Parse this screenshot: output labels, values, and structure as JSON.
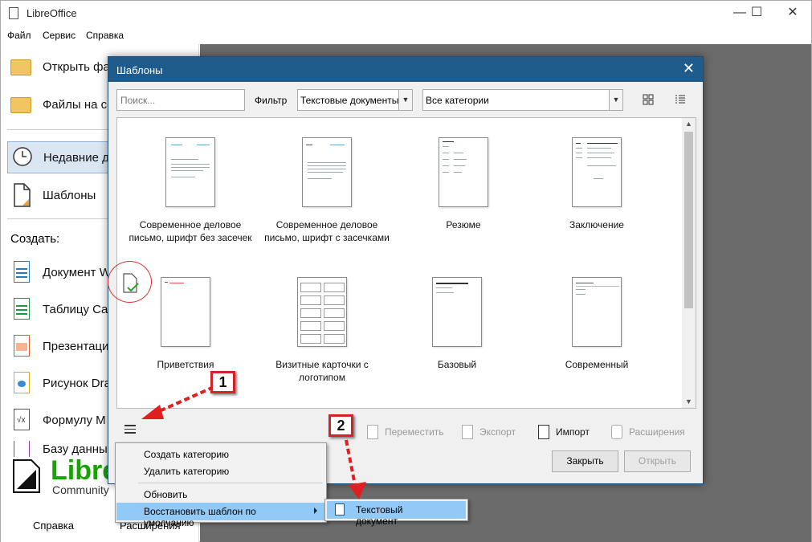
{
  "window": {
    "title": "LibreOffice",
    "controls": {
      "minimize": "—",
      "maximize": "☐",
      "close": "✕"
    }
  },
  "menubar": {
    "items": [
      {
        "label": "Файл"
      },
      {
        "label": "Сервис"
      },
      {
        "label": "Справка"
      }
    ]
  },
  "startcenter": {
    "open_file": "Открыть фа",
    "remote_files": "Файлы на се",
    "recent_docs": "Недавние д",
    "templates": "Шаблоны",
    "create_label": "Создать:",
    "create_items": [
      {
        "label": "Документ W",
        "color": "#2a7ab9"
      },
      {
        "label": "Таблицу Ca",
        "color": "#1e9940"
      },
      {
        "label": "Презентаци",
        "color": "#d95c1f"
      },
      {
        "label": "Рисунок Dra",
        "color": "#e0a81a"
      },
      {
        "label": "Формулу M",
        "color": "#7a7a7a"
      },
      {
        "label": "Базу данны",
        "color": "#8b3aa8"
      }
    ],
    "logo_text": "Libre",
    "logo_sub": "Community",
    "help_link": "Справка",
    "extensions_link": "Расширения"
  },
  "dialog": {
    "title": "Шаблоны",
    "search_placeholder": "Поиск...",
    "filter_label": "Фильтр",
    "filter_value": "Текстовые документы",
    "category_value": "Все категории",
    "templates": [
      {
        "name": "Современное деловое письмо, шрифт без засечек"
      },
      {
        "name": "Современное деловое письмо, шрифт с засечками"
      },
      {
        "name": "Резюме"
      },
      {
        "name": "Заключение"
      },
      {
        "name": "Приветствия"
      },
      {
        "name": "Визитные карточки с логотипом"
      },
      {
        "name": "Базовый"
      },
      {
        "name": "Современный"
      }
    ],
    "toolbar": {
      "move": "Переместить",
      "export": "Экспорт",
      "import": "Импорт",
      "extensions": "Расширения"
    },
    "buttons": {
      "close": "Закрыть",
      "open": "Открыть"
    }
  },
  "context_menu": {
    "items": [
      {
        "label": "Создать категорию"
      },
      {
        "label": "Удалить категорию"
      },
      {
        "label": "Обновить"
      },
      {
        "label": "Восстановить шаблон по умолчанию"
      }
    ],
    "submenu": {
      "label": "Текстовый документ"
    }
  },
  "annotations": {
    "badge_1": "1",
    "badge_2": "2",
    "arrow_color": "#e02020"
  }
}
